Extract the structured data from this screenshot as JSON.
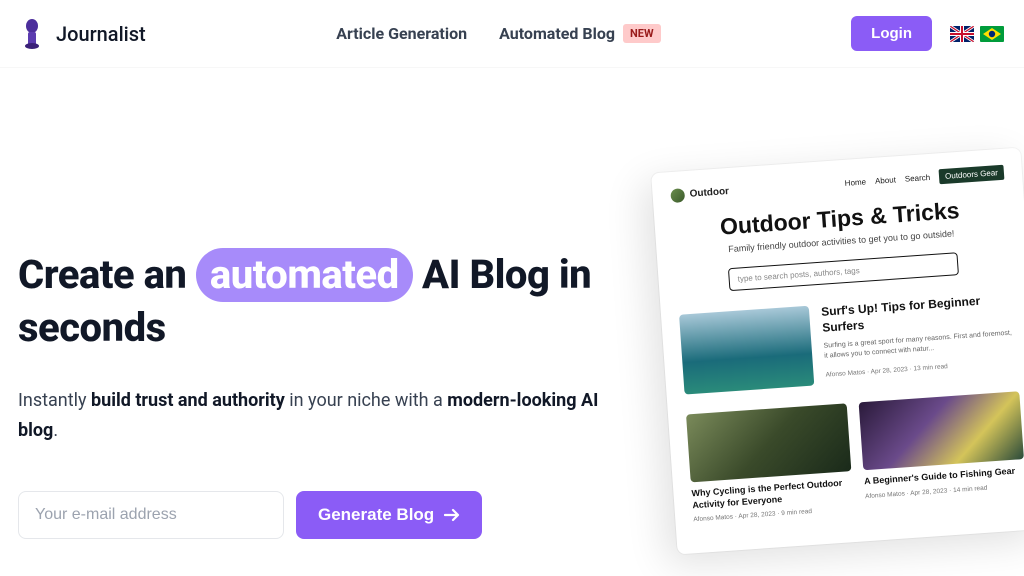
{
  "nav": {
    "brand": "Journalist",
    "links": {
      "article_gen": "Article Generation",
      "auto_blog": "Automated Blog",
      "new_badge": "NEW"
    },
    "login": "Login"
  },
  "hero": {
    "headline_pre": "Create an ",
    "headline_highlight": "automated",
    "headline_post": " AI Blog in seconds",
    "sub_pre": "Instantly ",
    "sub_bold1": "build trust and authority",
    "sub_mid": " in your niche with a ",
    "sub_bold2": "modern-looking AI blog",
    "sub_end": ".",
    "email_placeholder": "Your e-mail address",
    "cta": "Generate Blog"
  },
  "preview": {
    "logo": "Outdoor",
    "nav": {
      "home": "Home",
      "about": "About",
      "search": "Search",
      "cta": "Outdoors Gear"
    },
    "title": "Outdoor Tips & Tricks",
    "sub": "Family friendly outdoor activities to get you to go outside!",
    "search_ph": "type to search posts, authors, tags",
    "post1": {
      "title": "Surf's Up! Tips for Beginner Surfers",
      "desc": "Surfing is a great sport for many reasons. First and foremost, it allows you to connect with natur...",
      "meta": "Afonso Matos · Apr 28, 2023 · 13 min read"
    },
    "post2": {
      "title": "Why Cycling is the Perfect Outdoor Activity for Everyone",
      "meta": "Afonso Matos · Apr 28, 2023 · 9 min read"
    },
    "post3": {
      "title": "A Beginner's Guide to Fishing Gear",
      "meta": "Afonso Matos · Apr 28, 2023 · 14 min read"
    }
  }
}
